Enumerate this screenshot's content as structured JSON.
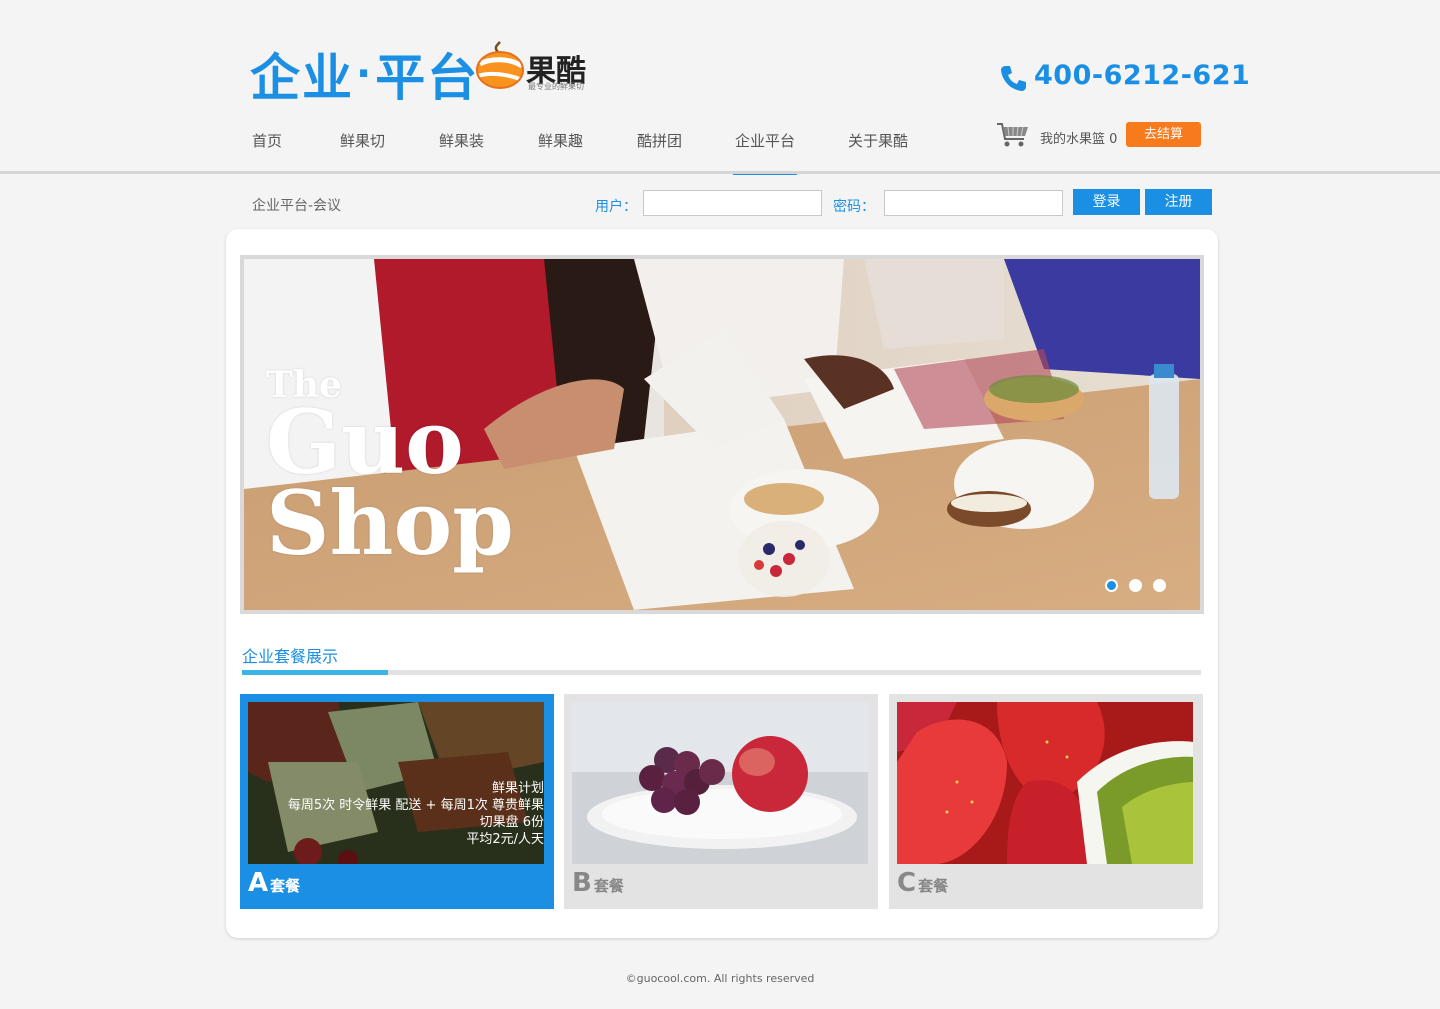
{
  "header": {
    "brand_title_part1": "企业",
    "brand_title_dot": "·",
    "brand_title_part2": "平台",
    "logo_text": "果酷",
    "logo_subtitle": "最专业的鲜果切",
    "phone": "400-6212-621"
  },
  "nav": {
    "items": [
      {
        "label": "首页",
        "active": false
      },
      {
        "label": "鲜果切",
        "active": false
      },
      {
        "label": "鲜果装",
        "active": false
      },
      {
        "label": "鲜果趣",
        "active": false
      },
      {
        "label": "酷拼团",
        "active": false
      },
      {
        "label": "企业平台",
        "active": true
      },
      {
        "label": "关于果酷",
        "active": false
      }
    ]
  },
  "cart": {
    "label": "我的水果篮 0",
    "checkout": "去结算"
  },
  "subbar": {
    "breadcrumb": "企业平台-会议",
    "user_label": "用户：",
    "password_label": "密码：",
    "user_value": "",
    "password_value": "",
    "login": "登录",
    "register": "注册"
  },
  "banner": {
    "the": "The",
    "guo": "Guo",
    "shop": "Shop",
    "slides": 3,
    "active_slide": 1
  },
  "section": {
    "title": "企业套餐展示"
  },
  "packages": [
    {
      "letter": "A",
      "suffix": "套餐",
      "active": true,
      "desc_line1": "鲜果计划",
      "desc_line2": "每周5次 时令鲜果 配送 + 每周1次 尊贵鲜果",
      "desc_line3": "切果盘 6份",
      "desc_line4": "平均2元/人天"
    },
    {
      "letter": "B",
      "suffix": "套餐",
      "active": false
    },
    {
      "letter": "C",
      "suffix": "套餐",
      "active": false
    }
  ],
  "footer": {
    "copyright": "©guocool.com. All rights reserved"
  },
  "colors": {
    "accent": "#1a8fe3",
    "checkout": "#f77a1c",
    "section_underline": "#3bb5e8"
  }
}
